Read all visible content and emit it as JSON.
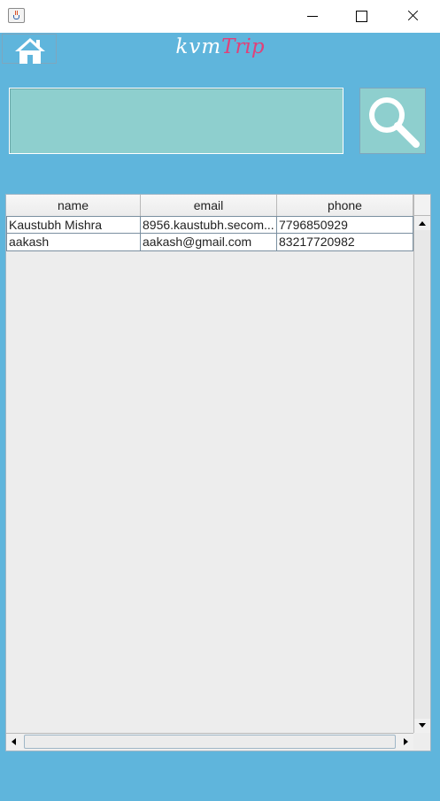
{
  "window": {
    "icon": "java-cup-icon"
  },
  "header": {
    "home_icon": "home-icon",
    "brand_part1": "kvm",
    "brand_part2": "Trip"
  },
  "search": {
    "value": "",
    "icon": "search-icon"
  },
  "table": {
    "columns": [
      "name",
      "email",
      "phone"
    ],
    "rows": [
      {
        "name": "Kaustubh Mishra",
        "email": "8956.kaustubh.secom...",
        "phone": "7796850929"
      },
      {
        "name": "aakash",
        "email": "aakash@gmail.com",
        "phone": "83217720982"
      }
    ]
  },
  "colors": {
    "background": "#5fb5dc",
    "search_field": "#8ecfce",
    "brand_accent": "#e0427a"
  }
}
